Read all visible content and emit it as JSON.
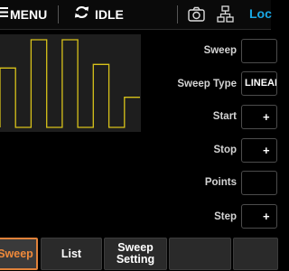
{
  "topbar": {
    "menu_label": "MENU",
    "status_label": "IDLE",
    "local_label": "Loc",
    "accent_color": "#19a8e6"
  },
  "chart": {
    "trace_color": "#d8c21a",
    "levels": [
      0.65,
      0,
      0.96,
      0,
      0.96,
      0,
      0.69,
      0,
      0.33
    ]
  },
  "params": [
    {
      "label": "Sweep",
      "value": ""
    },
    {
      "label": "Sweep Type",
      "value": "LINEAR"
    },
    {
      "label": "Start",
      "value": "+"
    },
    {
      "label": "Stop",
      "value": "+"
    },
    {
      "label": "Points",
      "value": ""
    },
    {
      "label": "Step",
      "value": "+"
    }
  ],
  "tabs": [
    {
      "label": "Sweep",
      "active": true
    },
    {
      "label": "List",
      "active": false
    },
    {
      "label": "Sweep Setting",
      "active": false
    },
    {
      "label": "",
      "active": false
    },
    {
      "label": "",
      "active": false
    }
  ],
  "active_color": "#f08a3a"
}
